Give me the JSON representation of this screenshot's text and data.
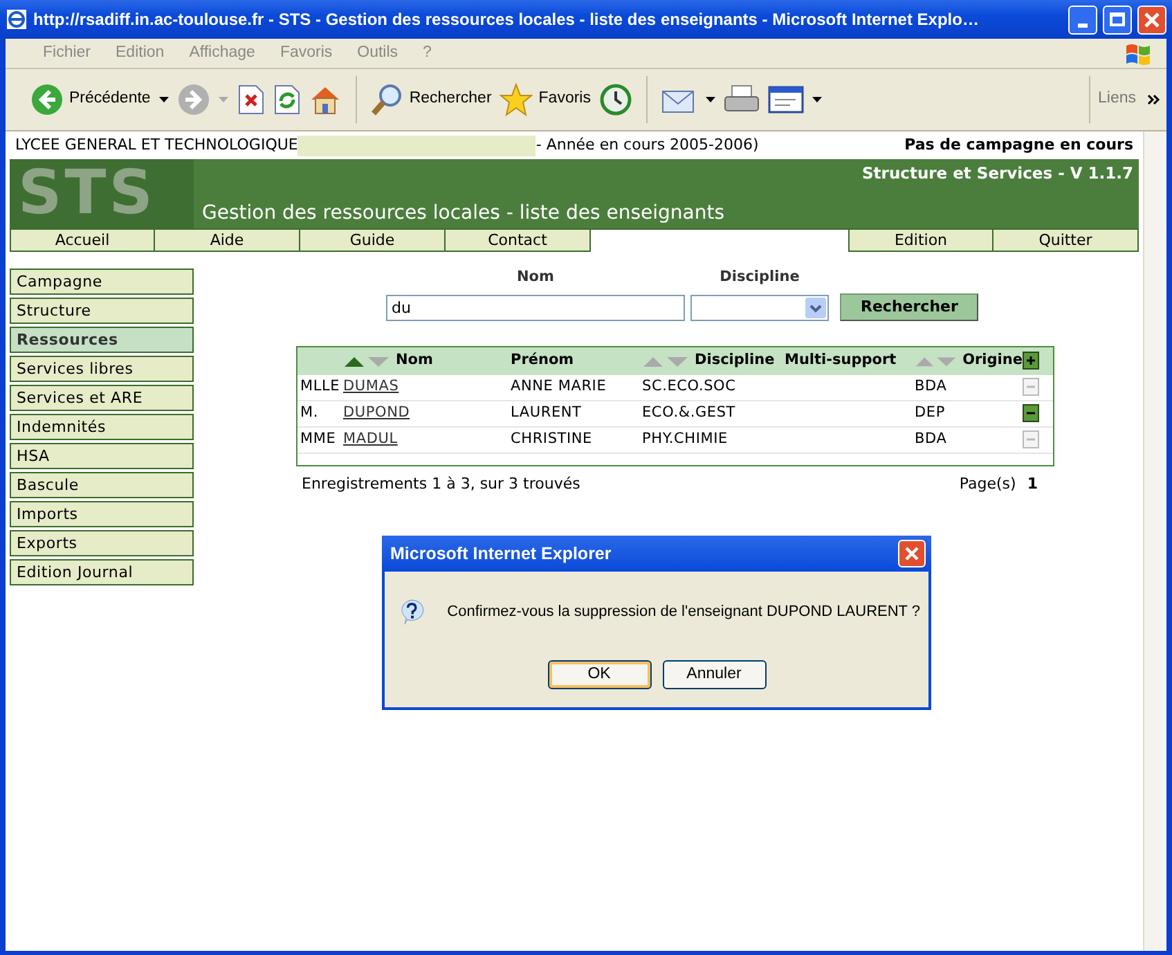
{
  "window": {
    "title": "http://rsadiff.in.ac-toulouse.fr - STS - Gestion des ressources locales - liste des enseignants - Microsoft Internet Explo…"
  },
  "menu": [
    "Fichier",
    "Edition",
    "Affichage",
    "Favoris",
    "Outils",
    "?"
  ],
  "toolbar": {
    "back_label": "Précédente",
    "search_label": "Rechercher",
    "favorites_label": "Favoris",
    "links_label": "Liens"
  },
  "page": {
    "school": "LYCEE GENERAL ET TECHNOLOGIQUE",
    "year": "- Année en cours 2005-2006)",
    "campaign": "Pas de campagne en cours",
    "logo": "STS",
    "version": "Structure et Services - V 1.1.7",
    "heading": "Gestion des ressources locales - liste des enseignants",
    "nav_left": [
      "Accueil",
      "Aide",
      "Guide",
      "Contact"
    ],
    "nav_right": [
      "Edition",
      "Quitter"
    ],
    "sidebar": {
      "items": [
        {
          "label": "Campagne",
          "selected": false
        },
        {
          "label": "Structure",
          "selected": false
        },
        {
          "label": "Ressources",
          "selected": true
        },
        {
          "label": "Services libres",
          "selected": false
        },
        {
          "label": "Services et ARE",
          "selected": false
        },
        {
          "label": "Indemnités",
          "selected": false
        },
        {
          "label": "HSA",
          "selected": false
        },
        {
          "label": "Bascule",
          "selected": false
        },
        {
          "label": "Imports",
          "selected": false
        },
        {
          "label": "Exports",
          "selected": false
        },
        {
          "label": "Edition Journal",
          "selected": false
        }
      ]
    },
    "search": {
      "name_label": "Nom",
      "name_value": "du",
      "discipline_label": "Discipline",
      "button": "Rechercher"
    },
    "table": {
      "columns": [
        {
          "label": "Nom",
          "kind": "sorted"
        },
        {
          "label": "Prénom",
          "kind": "plain"
        },
        {
          "label": "Discipline",
          "kind": "sortable"
        },
        {
          "label": "Multi-support",
          "kind": "plain"
        },
        {
          "label": "Origine",
          "kind": "sortable"
        }
      ],
      "rows": [
        {
          "civility": "MLLE",
          "nom": "DUMAS",
          "prenom": "ANNE MARIE",
          "discipline": "SC.ECO.SOC",
          "origine": "BDA",
          "selected": false
        },
        {
          "civility": "M.",
          "nom": "DUPOND",
          "prenom": "LAURENT",
          "discipline": "ECO.&.GEST",
          "origine": "DEP",
          "selected": true
        },
        {
          "civility": "MME",
          "nom": "MADUL",
          "prenom": "CHRISTINE",
          "discipline": "PHY.CHIMIE",
          "origine": "BDA",
          "selected": false
        }
      ]
    },
    "footer": {
      "records": "Enregistrements 1 à 3, sur 3 trouvés",
      "pages_label": "Page(s)",
      "page": "1"
    }
  },
  "dialog": {
    "title": "Microsoft Internet Explorer",
    "message": "Confirmez-vous la suppression de l'enseignant DUPOND LAURENT ?",
    "buttons": [
      {
        "label": "OK",
        "default": true
      },
      {
        "label": "Annuler",
        "default": false
      }
    ]
  }
}
